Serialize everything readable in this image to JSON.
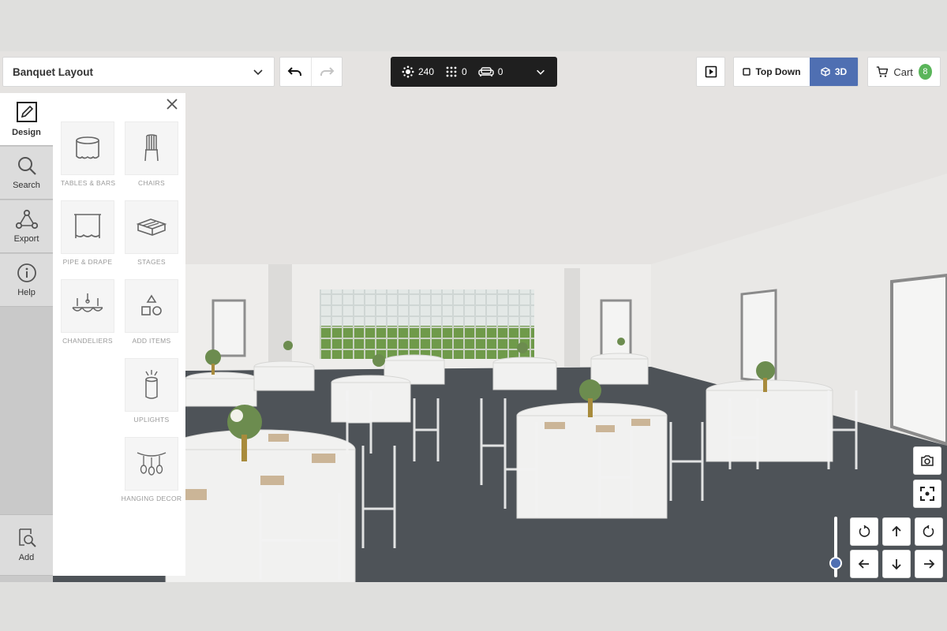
{
  "layout_select": {
    "value": "Banquet Layout"
  },
  "stats": {
    "guests": "240",
    "tables": "0",
    "lounge": "0"
  },
  "view": {
    "top_down": "Top Down",
    "three_d": "3D"
  },
  "cart": {
    "label": "Cart",
    "count": "8"
  },
  "rail": {
    "design": "Design",
    "search": "Search",
    "export": "Export",
    "help": "Help",
    "add": "Add"
  },
  "catalog": {
    "tables_bars": "TABLES & BARS",
    "chairs": "CHAIRS",
    "pipe_drape": "PIPE & DRAPE",
    "stages": "STAGES",
    "chandeliers": "CHANDELIERS",
    "add_items": "ADD ITEMS",
    "uplights": "UPLIGHTS",
    "hanging_decor": "HANGING DECOR"
  },
  "icons": {
    "undo": "undo-icon",
    "redo": "redo-icon",
    "guests": "guests-icon",
    "tables": "tables-grid-icon",
    "lounge": "sofa-icon",
    "play": "play-icon",
    "cart": "cart-icon",
    "camera": "camera-icon",
    "focus": "focus-icon"
  },
  "colors": {
    "accent": "#4f6fb2",
    "badge": "#5ab55a",
    "floor": "#4e5358"
  }
}
